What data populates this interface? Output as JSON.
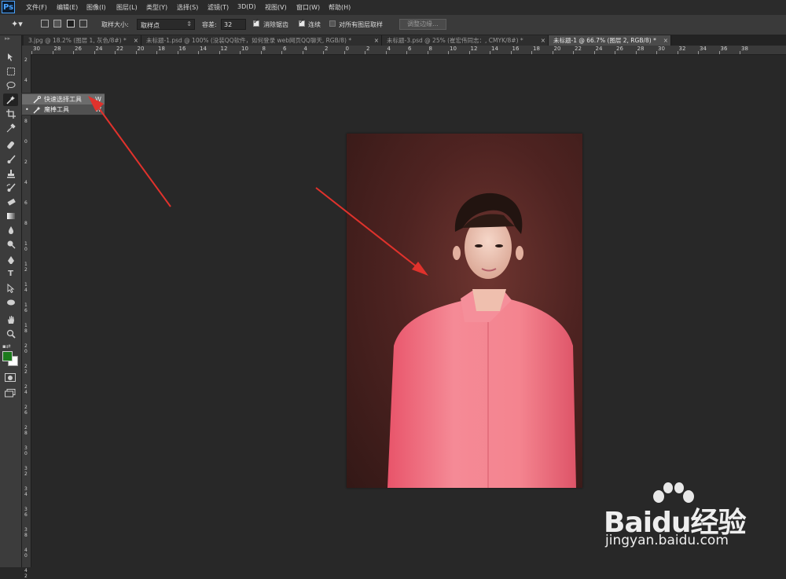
{
  "app": {
    "logo": "Ps"
  },
  "menu": [
    "文件(F)",
    "编辑(E)",
    "图像(I)",
    "图层(L)",
    "类型(Y)",
    "选择(S)",
    "滤镜(T)",
    "3D(D)",
    "视图(V)",
    "窗口(W)",
    "帮助(H)"
  ],
  "options": {
    "sample_size_label": "取样大小:",
    "sample_size_value": "取样点",
    "tolerance_label": "容差:",
    "tolerance_value": "32",
    "antialias_label": "消除锯齿",
    "antialias_checked": true,
    "contiguous_label": "连续",
    "contiguous_checked": true,
    "all_layers_label": "对所有图层取样",
    "all_layers_checked": false,
    "refine_edge_label": "调整边缘..."
  },
  "tabs": [
    {
      "label": "3.jpg @ 18.2% (图层 1, 灰色/8#) *",
      "active": false
    },
    {
      "label": "未标题-1.psd @ 100% (没装QQ软件，如何登录 web网页QQ聊天, RGB/8) *",
      "active": false
    },
    {
      "label": "未标题-3.psd @ 25% (崔宏伟同志：, CMYK/8#) *",
      "active": false
    },
    {
      "label": "未标题-1 @ 66.7% (图层 2, RGB/8) *",
      "active": true
    }
  ],
  "tab_close_glyph": "×",
  "hruler_labels": [
    "30",
    "28",
    "26",
    "24",
    "22",
    "20",
    "18",
    "16",
    "14",
    "12",
    "10",
    "8",
    "6",
    "4",
    "2",
    "0",
    "2",
    "4",
    "6",
    "8",
    "10",
    "12",
    "14",
    "16",
    "18",
    "20",
    "22",
    "24",
    "26",
    "28",
    "30",
    "32",
    "34",
    "36",
    "38"
  ],
  "vruler_labels": [
    "2",
    "4",
    "6",
    "8",
    "0",
    "2",
    "4",
    "6",
    "8",
    "1\n0",
    "1\n2",
    "1\n4",
    "1\n6",
    "1\n8",
    "2\n0",
    "2\n2",
    "2\n4",
    "2\n6",
    "2\n8",
    "3\n0",
    "3\n2",
    "3\n4",
    "3\n6",
    "3\n8",
    "4\n0",
    "4\n2"
  ],
  "tools": [
    "move-tool",
    "marquee-tool",
    "lasso-tool",
    "magic-wand-tool",
    "crop-tool",
    "eyedropper-tool",
    "healing-brush-tool",
    "brush-tool",
    "clone-stamp-tool",
    "history-brush-tool",
    "eraser-tool",
    "gradient-tool",
    "blur-tool",
    "dodge-tool",
    "pen-tool",
    "type-tool",
    "path-selection-tool",
    "ellipse-tool",
    "hand-tool",
    "zoom-tool"
  ],
  "type_tool_glyph": "T",
  "colors": {
    "foreground": "#1c7a1c",
    "background": "#ffffff",
    "arrow": "#e0322c",
    "doc_bg": "#4e2321",
    "robe": "#f07080"
  },
  "flyout": {
    "items": [
      {
        "label": "快速选择工具",
        "shortcut": "W",
        "selected": true
      },
      {
        "label": "魔棒工具",
        "shortcut": "W",
        "selected": false
      }
    ]
  },
  "watermark": {
    "brand_text": "Baidu经验",
    "url": "jingyan.baidu.com"
  }
}
